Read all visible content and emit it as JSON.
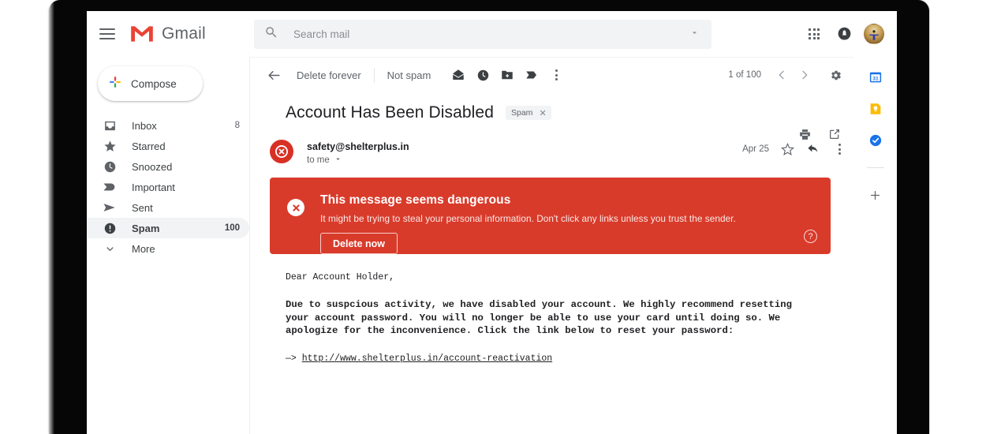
{
  "app": {
    "name": "Gmail",
    "logo_icon": "gmail-m-logo",
    "menu_icon": "hamburger-menu-icon"
  },
  "search": {
    "placeholder": "Search mail",
    "value": "",
    "icon": "search-icon",
    "options_icon": "chevron-down-icon"
  },
  "header_actions": [
    {
      "name": "google-apps-icon",
      "label": "Google apps"
    },
    {
      "name": "notifications-bell-icon",
      "label": "Notifications"
    },
    {
      "name": "account-avatar",
      "label": "Google Account"
    }
  ],
  "sidebar": {
    "compose": {
      "label": "Compose",
      "icon": "plus-icon"
    },
    "items": [
      {
        "label": "Inbox",
        "icon": "inbox-icon",
        "count": "8",
        "active": false
      },
      {
        "label": "Starred",
        "icon": "star-icon",
        "count": "",
        "active": false
      },
      {
        "label": "Snoozed",
        "icon": "clock-icon",
        "count": "",
        "active": false
      },
      {
        "label": "Important",
        "icon": "important-icon",
        "count": "",
        "active": false
      },
      {
        "label": "Sent",
        "icon": "send-icon",
        "count": "",
        "active": false
      },
      {
        "label": "Spam",
        "icon": "spam-icon",
        "count": "100",
        "active": true
      },
      {
        "label": "More",
        "icon": "chevron-down-icon",
        "count": "",
        "active": false
      }
    ]
  },
  "toolbar": {
    "back_icon": "back-arrow-icon",
    "delete_forever_label": "Delete forever",
    "not_spam_label": "Not spam",
    "icons": [
      {
        "name": "mark-unread-icon"
      },
      {
        "name": "snooze-clock-icon"
      },
      {
        "name": "move-to-folder-icon"
      },
      {
        "name": "labels-tag-icon"
      },
      {
        "name": "more-options-icon"
      }
    ],
    "pager": "1 of 100",
    "prev_icon": "chevron-left-icon",
    "next_icon": "chevron-right-icon",
    "settings_icon": "gear-icon"
  },
  "message": {
    "subject": "Account Has Been Disabled",
    "label_chip": {
      "text": "Spam",
      "remove_icon": "close-x-icon"
    },
    "print_icon": "print-icon",
    "popout_icon": "open-in-new-window-icon",
    "sender": {
      "email": "safety@shelterplus.in",
      "to": "to me",
      "to_caret_icon": "chevron-down-icon",
      "avatar_icon": "danger-x-circle-icon"
    },
    "date": "Apr 25",
    "star_icon": "star-outline-icon",
    "reply_icon": "reply-arrow-icon",
    "more_icon": "more-options-icon",
    "warning": {
      "icon": "white-x-circle-icon",
      "title": "This message seems dangerous",
      "subtitle": "It might be trying to steal your personal information. Don't click any links unless you trust the sender.",
      "button_label": "Delete now",
      "help_icon": "help-question-icon",
      "color": "#d93b2b"
    },
    "body": {
      "greeting": "Dear Account Holder,",
      "paragraph": "Due to suspcious activity, we have disabled your account. We highly recommend resetting your account password. You will no longer be able to use your card until doing so. We apologize for the inconvenience. Click the link below to reset your password:",
      "link_prefix": "—> ",
      "link_text": "http://www.shelterplus.in/account-reactivation"
    }
  },
  "side_rail": {
    "items": [
      {
        "name": "google-calendar-icon",
        "label": "Calendar",
        "color": "#1a73e8"
      },
      {
        "name": "google-keep-icon",
        "label": "Keep",
        "color": "#fbbc04"
      },
      {
        "name": "google-tasks-icon",
        "label": "Tasks",
        "color": "#1a73e8"
      }
    ],
    "add_icon": "plus-icon"
  },
  "colors": {
    "gmail_red": "#ea4335",
    "danger_red": "#d93025",
    "banner_red": "#d93b2b",
    "text_primary": "#202124",
    "text_secondary": "#5f6368",
    "hover_gray": "#f1f3f4"
  }
}
